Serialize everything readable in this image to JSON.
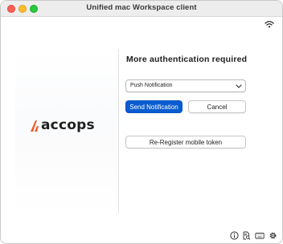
{
  "window": {
    "title": "Unified mac Workspace client"
  },
  "brand": {
    "logo_text": "accops",
    "accent": "#f05a28"
  },
  "auth": {
    "heading": "More authentication required",
    "method_selected": "Push Notification",
    "send_label": "Send Notification",
    "cancel_label": "Cancel",
    "reregister_label": "Re-Register mobile token"
  },
  "colors": {
    "primary_button": "#0a5cd0",
    "traffic_close": "#fe5f57",
    "traffic_minimize": "#febc2e",
    "traffic_zoom": "#28c840"
  },
  "icons": {
    "status": "wifi-icon",
    "footer": [
      "info-icon",
      "doc-search-icon",
      "keyboard-icon",
      "gear-icon"
    ]
  }
}
